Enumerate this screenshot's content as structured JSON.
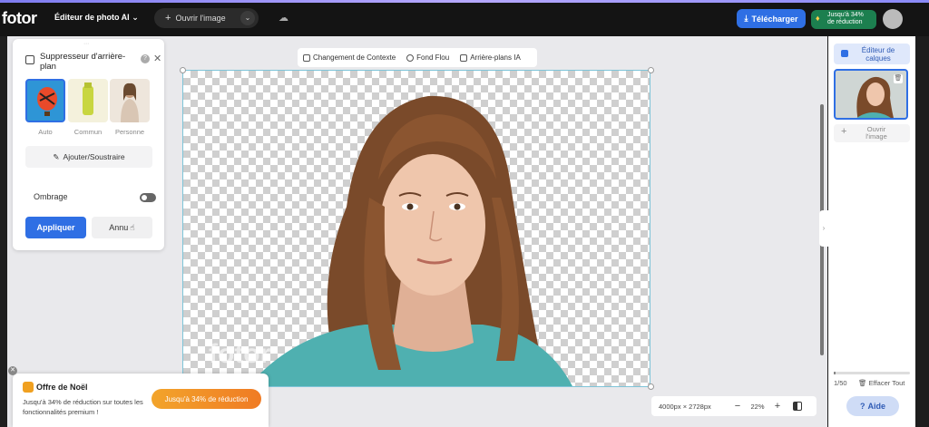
{
  "header": {
    "logo": "fotor",
    "editor_menu": "Éditeur de photo AI",
    "open_image": "Ouvrir l'image",
    "download": "Télécharger",
    "promo_line1": "Jusqu'à 34%",
    "promo_line2": "de réduction"
  },
  "panel": {
    "title": "Suppresseur d'arrière-plan",
    "modes": [
      {
        "label": "Auto"
      },
      {
        "label": "Commun"
      },
      {
        "label": "Personne"
      }
    ],
    "add_subtract": "Ajouter/Soustraire",
    "shadow_label": "Ombrage",
    "shadow_enabled": false,
    "apply": "Appliquer",
    "cancel": "Annu"
  },
  "canvas_toolbar": {
    "items": [
      {
        "label": "Changement de Contexte",
        "icon": "context-icon"
      },
      {
        "label": "Fond Flou",
        "icon": "blur-icon"
      },
      {
        "label": "Arrière-plans IA",
        "icon": "ai-background-icon"
      }
    ]
  },
  "canvas": {
    "watermark": "fotor"
  },
  "right_panel": {
    "layer_editor": "Éditeur de\ncalques",
    "open_image": "Ouvrir\nl'image",
    "page_info": "1/50",
    "page_fraction": 0.02,
    "clear_all": "Effacer Tout",
    "help": "Aide"
  },
  "promo": {
    "title": "Offre de Noël",
    "text": "Jusqu'à 34% de réduction sur toutes les fonctionnalités premium !",
    "cta": "Jusqu'à 34% de réduction"
  },
  "zoom": {
    "dimensions": "4000px × 2728px",
    "minus": "−",
    "value": "22%",
    "plus": "+"
  },
  "colors": {
    "accent": "#2f6fe4",
    "promo_green": "#1c7f4f",
    "promo_orange": "#f07b24"
  }
}
